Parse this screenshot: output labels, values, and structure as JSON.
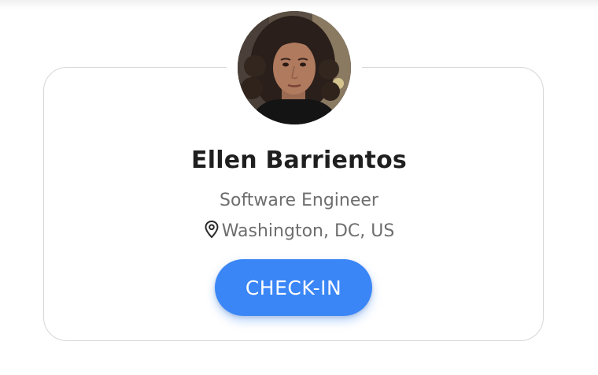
{
  "profile": {
    "name": "Ellen Barrientos",
    "title": "Software Engineer",
    "location": "Washington, DC, US",
    "location_icon": "map-pin-icon",
    "avatar_description": "profile-photo"
  },
  "actions": {
    "checkin_label": "CHECK-IN"
  },
  "colors": {
    "accent": "#3a86f7",
    "card_border": "#d6d6d6",
    "name_text": "#1f1f1f",
    "secondary_text": "#6e6e6e"
  }
}
